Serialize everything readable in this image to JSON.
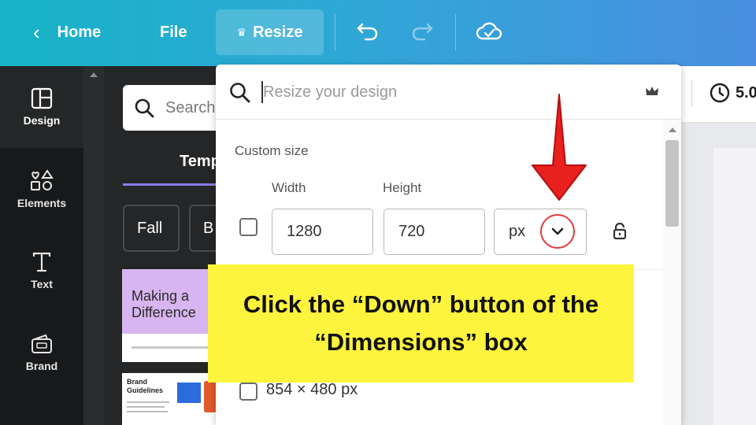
{
  "topbar": {
    "home_label": "Home",
    "file_label": "File",
    "resize_label": "Resize",
    "crown_icon": "crown-icon",
    "undo_icon": "undo-icon",
    "redo_icon": "redo-icon",
    "save_status_icon": "cloud-check-icon"
  },
  "rail": {
    "items": [
      {
        "label": "Design",
        "icon": "layout-icon"
      },
      {
        "label": "Elements",
        "icon": "shapes-icon"
      },
      {
        "label": "Text",
        "icon": "text-icon"
      },
      {
        "label": "Brand",
        "icon": "brand-kit-icon"
      }
    ]
  },
  "panel": {
    "search_placeholder": "Search",
    "tab_label": "Temp",
    "chips": [
      "Fall",
      "B"
    ],
    "template1_title": "Making a Difference",
    "template2_title": "Brand Guidelines"
  },
  "canvas": {
    "timer_value": "5.0"
  },
  "resize_dropdown": {
    "search_placeholder": "Resize your design",
    "custom_size_label": "Custom size",
    "width_label": "Width",
    "height_label": "Height",
    "width_value": "1280",
    "height_value": "720",
    "unit_value": "px",
    "preset_option": "854 × 480 px"
  },
  "annotation": {
    "text": "Click the “Down” button of the “Dimensions” box",
    "highlight_color": "#fff43d",
    "arrow_color": "#e8201e"
  }
}
